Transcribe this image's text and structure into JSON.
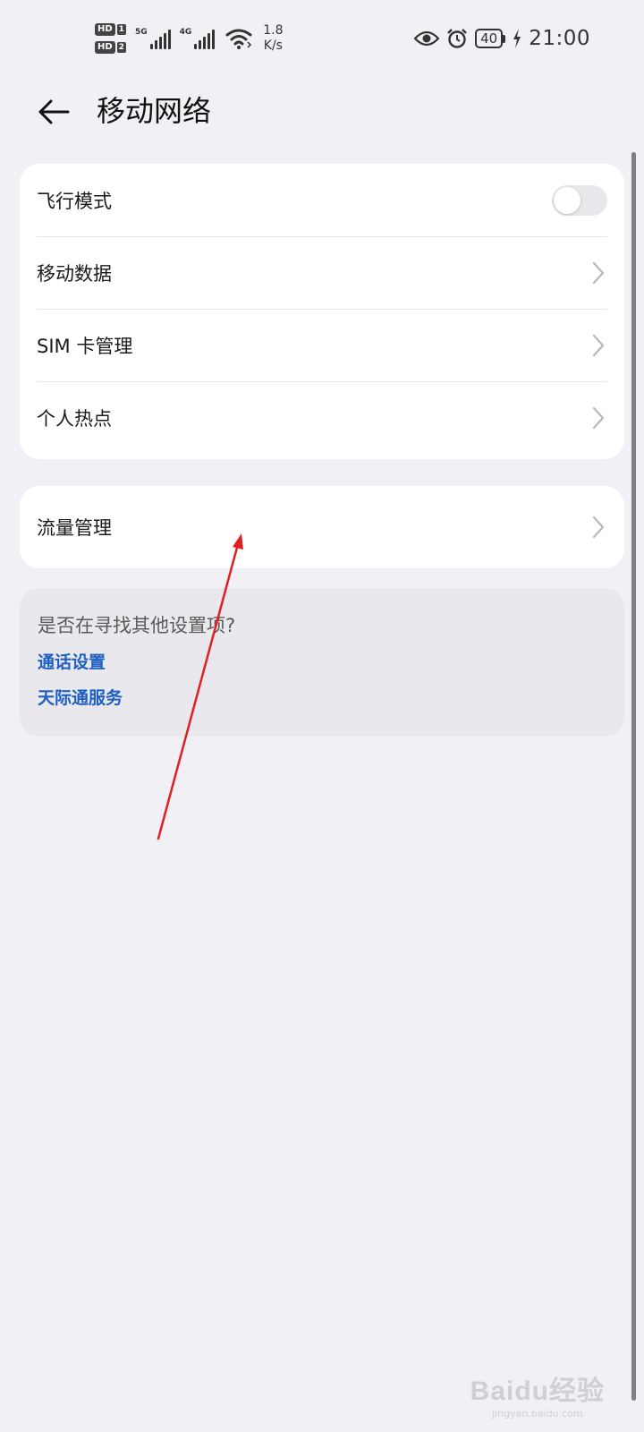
{
  "status_bar": {
    "hd1": "HD",
    "hd1_num": "1",
    "hd2": "HD",
    "hd2_num": "2",
    "signal1_label": "5G",
    "signal2_label": "4G",
    "speed_value": "1.8",
    "speed_unit": "K/s",
    "battery": "40",
    "time": "21:00",
    "icons": [
      "wifi-icon",
      "eye-icon",
      "alarm-icon",
      "battery-icon",
      "charging-icon"
    ]
  },
  "header": {
    "title": "移动网络",
    "back_icon": "back-arrow-icon"
  },
  "main": {
    "card1": [
      {
        "label": "飞行模式",
        "control": "toggle",
        "on": false
      },
      {
        "label": "移动数据",
        "control": "chevron"
      },
      {
        "label": "SIM 卡管理",
        "control": "chevron"
      },
      {
        "label": "个人热点",
        "control": "chevron"
      }
    ],
    "card2": [
      {
        "label": "流量管理",
        "control": "chevron"
      }
    ]
  },
  "suggestions": {
    "title": "是否在寻找其他设置项?",
    "links": [
      "通话设置",
      "天际通服务"
    ]
  },
  "watermark": {
    "logo": "Baidu经验",
    "url": "jingyan.baidu.com"
  },
  "colors": {
    "background": "#f1f1f5",
    "card": "#ffffff",
    "link": "#1f5fbf",
    "annotation_arrow": "#e02020"
  }
}
